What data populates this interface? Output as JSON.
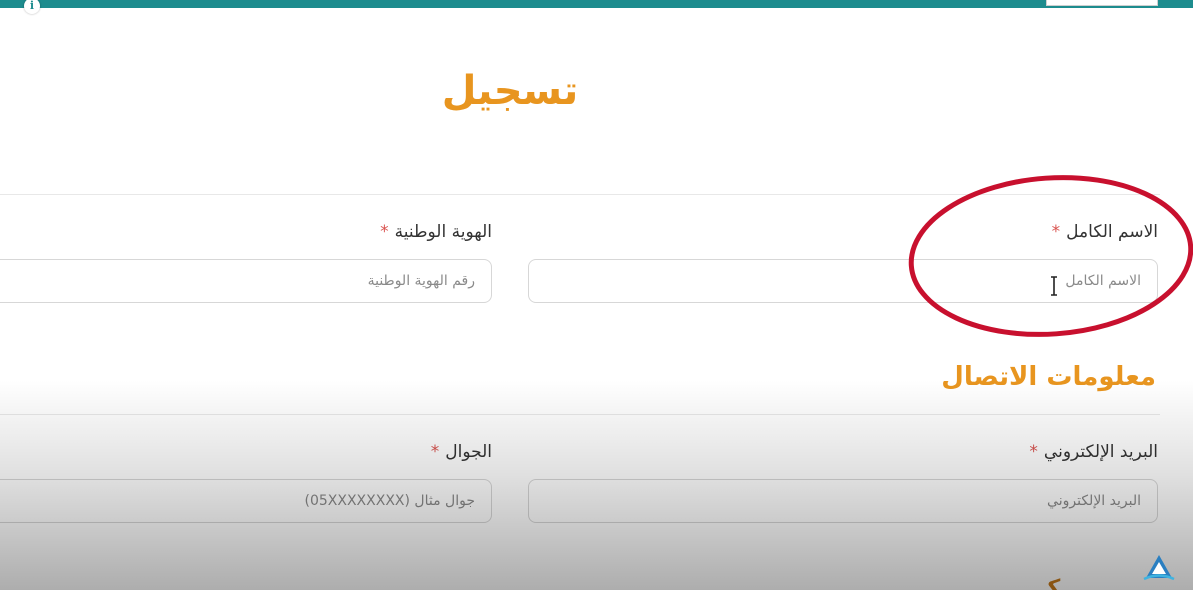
{
  "form": {
    "title": "تسجيل",
    "required_mark": "*",
    "full_name": {
      "label": "الاسم الكامل",
      "placeholder": "الاسم الكامل"
    },
    "national_id": {
      "label": "الهوية الوطنية",
      "placeholder": "رقم الهوية الوطنية"
    },
    "contact_section": {
      "title": "معلومات الاتصال"
    },
    "email": {
      "label": "البريد الإلكتروني",
      "placeholder": "البريد الإلكتروني"
    },
    "mobile": {
      "label": "الجوال",
      "placeholder": "جوال مثال (05XXXXXXXX)"
    }
  },
  "colors": {
    "accent": "#e8951f",
    "top_bar": "#1d8c8e",
    "highlight_circle": "#c8102e",
    "required": "#d9534f"
  },
  "icons": {
    "info": "info-icon",
    "cursor": "text-cursor-icon",
    "watermark": "logo-icon"
  }
}
